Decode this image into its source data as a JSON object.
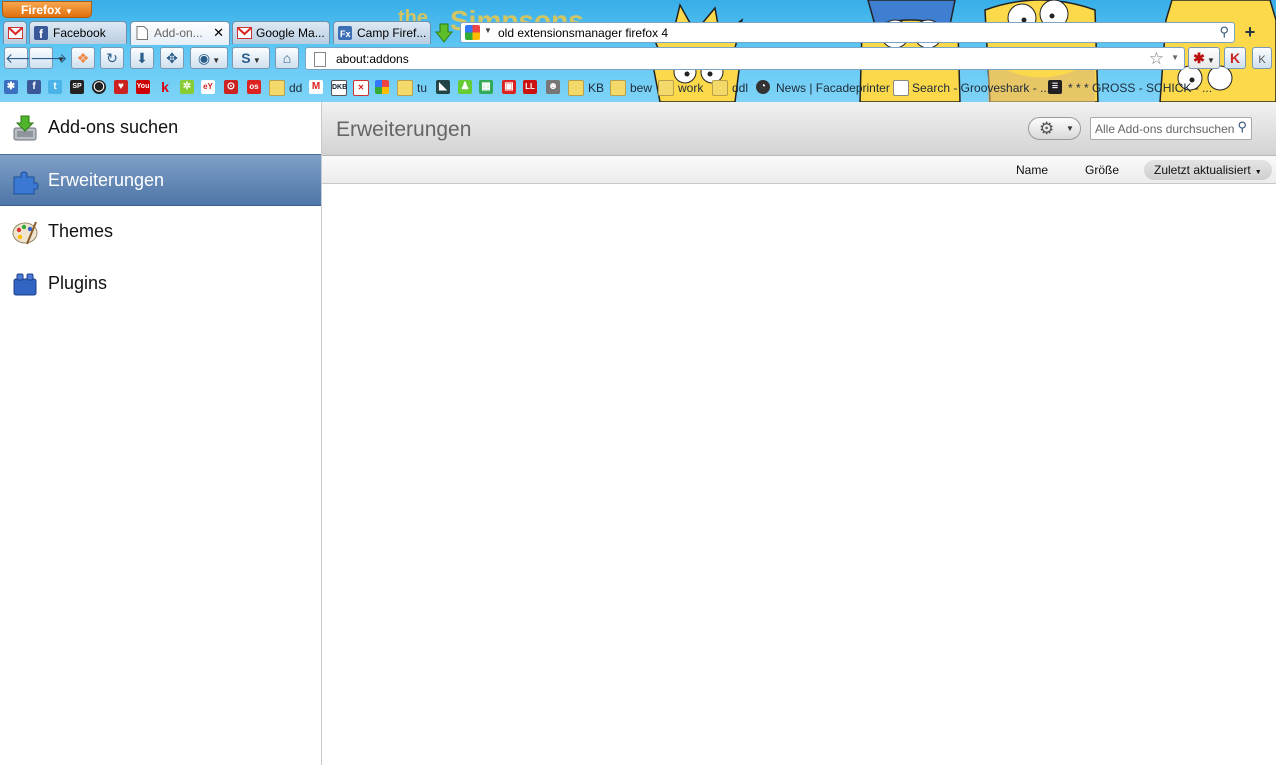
{
  "browser": {
    "app_menu_label": "Firefox",
    "tabs": [
      {
        "label": "",
        "icon": "gmail-icon",
        "active": false
      },
      {
        "label": "Facebook",
        "icon": "facebook-icon",
        "active": false
      },
      {
        "label": "Add-on...",
        "icon": "page-icon",
        "active": true
      },
      {
        "label": "Google Ma...",
        "icon": "gmail-icon",
        "active": false
      },
      {
        "label": "Camp Firef...",
        "icon": "firefox-icon",
        "active": false
      }
    ],
    "tab_close_glyph": "✕",
    "search_value": "old extensionsmanager firefox 4",
    "url": "about:addons",
    "bookmarks": {
      "dd": "dd",
      "tu": "tu",
      "kb": "KB",
      "bew": "bew",
      "work": "work",
      "ddl": "ddl",
      "news": "News | Facadeprinter",
      "grooveshark": "Search - Grooveshark - ...",
      "gross": "* * * GROSS - SCHICK - ..."
    }
  },
  "sidebar": {
    "items": [
      {
        "label": "Add-ons suchen",
        "icon": "download-addons-icon",
        "selected": false
      },
      {
        "label": "Erweiterungen",
        "icon": "puzzle-piece-icon",
        "selected": true
      },
      {
        "label": "Themes",
        "icon": "paint-palette-icon",
        "selected": false
      },
      {
        "label": "Plugins",
        "icon": "lego-block-icon",
        "selected": false
      }
    ]
  },
  "main": {
    "title": "Erweiterungen",
    "search_placeholder": "Alle Add-ons durchsuchen",
    "sort": {
      "name": "Name",
      "size": "Größe",
      "updated": "Zuletzt aktualisiert"
    }
  },
  "colors": {
    "selected_category": "#5a80b0",
    "firefox_button": "#e8831f"
  }
}
